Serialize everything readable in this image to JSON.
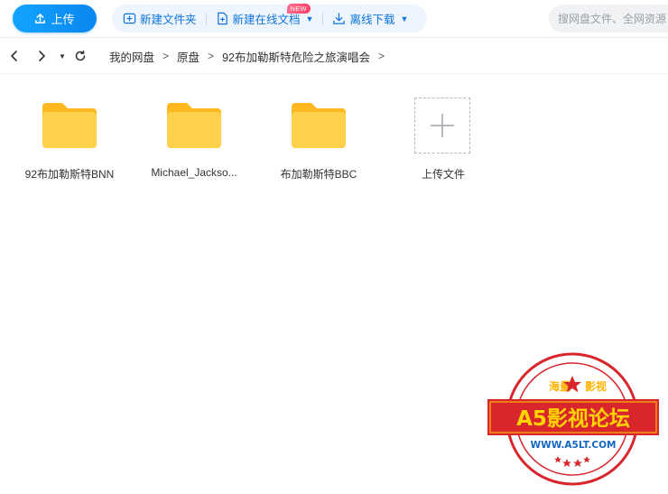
{
  "toolbar": {
    "upload_label": "上传",
    "new_folder_label": "新建文件夹",
    "new_online_doc_label": "新建在线文档",
    "new_badge": "NEW",
    "offline_download_label": "离线下载",
    "search_placeholder": "搜网盘文件、全网资源"
  },
  "breadcrumb": [
    "我的网盘",
    "原盘",
    "92布加勒斯特危险之旅演唱会"
  ],
  "files": [
    {
      "name": "92布加勒斯特BNN",
      "type": "folder"
    },
    {
      "name": "Michael_Jackso...",
      "type": "folder"
    },
    {
      "name": "布加勒斯特BBC",
      "type": "folder"
    }
  ],
  "upload_tile": {
    "label": "上传文件"
  },
  "watermark": {
    "top_text_left": "海量",
    "top_text_right": "影视",
    "main_text": "A5影视论坛",
    "url": "WWW.A5LT.COM"
  },
  "colors": {
    "accent": "#0a86f0",
    "folder": "#ffc53d",
    "stamp_red": "#d9262c",
    "stamp_yellow": "#ffd400"
  }
}
